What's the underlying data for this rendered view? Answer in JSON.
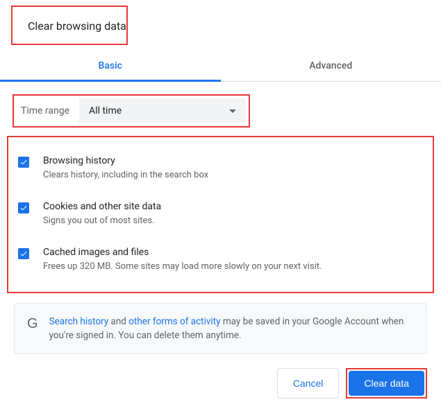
{
  "title": "Clear browsing data",
  "tabs": {
    "basic": "Basic",
    "advanced": "Advanced"
  },
  "time_range": {
    "label": "Time range",
    "value": "All time"
  },
  "options": [
    {
      "title": "Browsing history",
      "desc": "Clears history, including in the search box",
      "checked": true
    },
    {
      "title": "Cookies and other site data",
      "desc": "Signs you out of most sites.",
      "checked": true
    },
    {
      "title": "Cached images and files",
      "desc": "Frees up 320 MB. Some sites may load more slowly on your next visit.",
      "checked": true
    }
  ],
  "info": {
    "link1": "Search history",
    "text1": " and ",
    "link2": "other forms of activity",
    "text2": " may be saved in your Google Account when you're signed in. You can delete them anytime."
  },
  "buttons": {
    "cancel": "Cancel",
    "clear": "Clear data"
  },
  "highlight_color": "#e53935",
  "accent_color": "#1a73e8"
}
